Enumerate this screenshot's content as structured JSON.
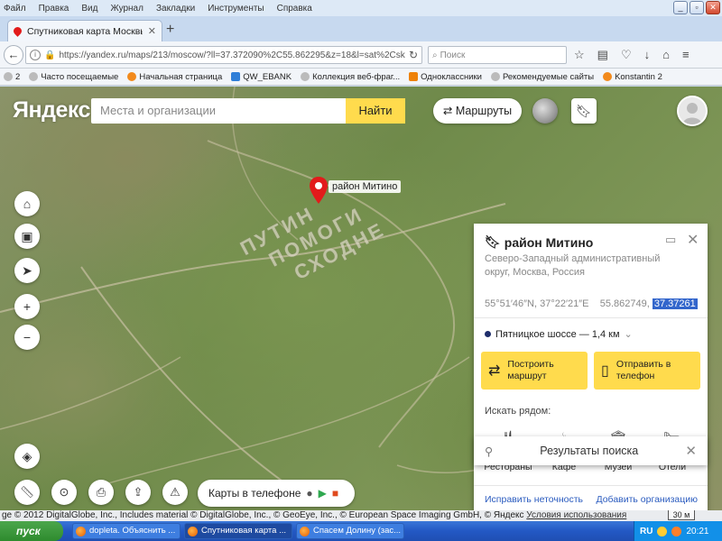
{
  "menu": [
    "Файл",
    "Правка",
    "Вид",
    "Журнал",
    "Закладки",
    "Инструменты",
    "Справка"
  ],
  "tab": {
    "title": "Спутниковая карта Москвы..."
  },
  "url": "https://yandex.ru/maps/213/moscow/?ll=37.372090%2C55.862295&z=18&l=sat%2Cskl&mod",
  "browser_search_placeholder": "Поиск",
  "bookmarks": [
    {
      "label": "2"
    },
    {
      "label": "Часто посещаемые"
    },
    {
      "label": "Начальная страница"
    },
    {
      "label": "QW_EBANK"
    },
    {
      "label": "Коллекция веб-фраг..."
    },
    {
      "label": "Одноклассники"
    },
    {
      "label": "Рекомендуемые сайты"
    },
    {
      "label": "Konstantin 2"
    }
  ],
  "map": {
    "logo": "Яндекс",
    "search_placeholder": "Места и организации",
    "find_label": "Найти",
    "routes_label": "Маршруты",
    "marker_label": "район Митино",
    "ground_text": [
      "ПУТИН",
      "ПОМОГИ",
      "СХОДНЕ"
    ],
    "app_promo": "Карты в телефоне",
    "copyright": "ge © 2012 DigitalGlobe, Inc., Includes material © DigitalGlobe, Inc., © GeoEye, Inc., © European Space Imaging GmbH, © Яндекс",
    "terms_link": "Условия использования",
    "scale": "30 м"
  },
  "card": {
    "title": "район Митино",
    "address": "Северо-Западный административный округ, Москва, Россия",
    "coords_dms": "55°51′46″N, 37°22′21″E",
    "lat": "55.862749,",
    "lon": "37.37261",
    "metro": "Пятницкое шоссе — 1,4 км",
    "build_route": "Построить маршрут",
    "send_phone": "Отправить в телефон",
    "nearby_label": "Искать рядом:",
    "pois": [
      "Рестораны",
      "Кафе",
      "Музеи",
      "Отели"
    ],
    "fix_link": "Исправить неточность",
    "add_org_link": "Добавить организацию"
  },
  "results": {
    "title": "Результаты поиска"
  },
  "taskbar": {
    "start": "пуск",
    "tasks": [
      "dopleta. Объяснить ...",
      "Спутниковая карта ...",
      "Спасем Долину (зас..."
    ],
    "lang": "RU",
    "time": "20:21"
  },
  "colors": {
    "accent_yellow": "#ffdb4d",
    "marker_red": "#e21b1b",
    "link_blue": "#2a5bbf"
  }
}
